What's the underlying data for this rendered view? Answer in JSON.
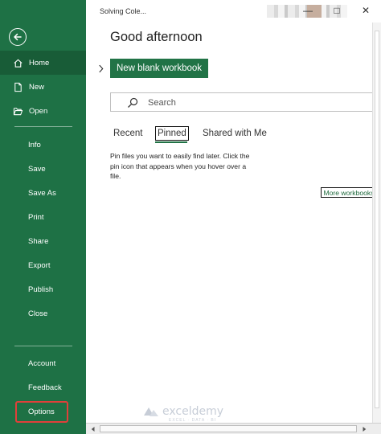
{
  "window": {
    "title": "Solving Cole...",
    "controls": {
      "minimize": "—",
      "maximize": "□",
      "close": "✕"
    }
  },
  "sidebar": {
    "back_icon": "back-arrow-icon",
    "top_items": [
      {
        "label": "Home",
        "icon": "home-icon",
        "active": true
      },
      {
        "label": "New",
        "icon": "new-document-icon"
      },
      {
        "label": "Open",
        "icon": "open-folder-icon"
      }
    ],
    "middle_items": [
      "Info",
      "Save",
      "Save As",
      "Print",
      "Share",
      "Export",
      "Publish",
      "Close"
    ],
    "bottom_items": [
      "Account",
      "Feedback",
      "Options"
    ],
    "highlighted_item": "Options",
    "highlight_color": "#e0403a"
  },
  "main": {
    "greeting": "Good afternoon",
    "new_blank_workbook": "New blank workbook",
    "search": {
      "placeholder": "Search",
      "value": ""
    },
    "tabs": [
      "Recent",
      "Pinned",
      "Shared with Me"
    ],
    "selected_tab": "Pinned",
    "pinned_message": "Pin files you want to easily find later. Click the pin icon that appears when you hover over a file.",
    "more_workbooks": "More workbooks"
  },
  "watermark": {
    "name": "exceldemy",
    "tagline": "EXCEL · DATA · BI"
  },
  "colors": {
    "sidebar": "#1e7145",
    "sidebar_active": "#185c37",
    "accent": "#217346"
  }
}
